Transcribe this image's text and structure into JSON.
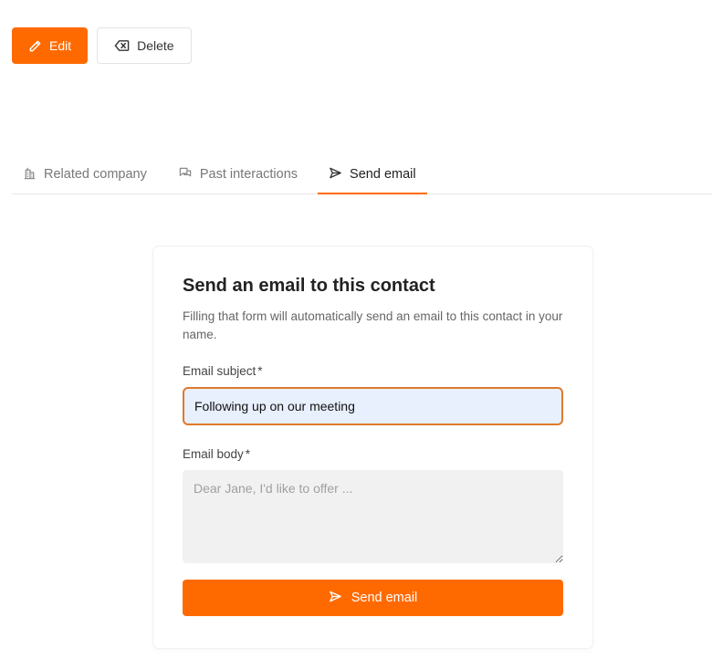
{
  "toolbar": {
    "edit_label": "Edit",
    "edit_icon": "pencil-icon",
    "delete_label": "Delete",
    "delete_icon": "backspace-x-icon"
  },
  "tabs": [
    {
      "label": "Related company",
      "icon": "building-icon",
      "active": false
    },
    {
      "label": "Past interactions",
      "icon": "chat-bubbles-icon",
      "active": false
    },
    {
      "label": "Send email",
      "icon": "send-icon",
      "active": true
    }
  ],
  "form": {
    "title": "Send an email to this contact",
    "description": "Filling that form will automatically send an email to this contact in your name.",
    "subject_label": "Email subject",
    "subject_required": "*",
    "subject_value": "Following up on our meeting",
    "body_label": "Email body",
    "body_required": "*",
    "body_placeholder": "Dear Jane, I'd like to offer ...",
    "submit_label": "Send email",
    "submit_icon": "send-icon"
  },
  "colors": {
    "accent": "#ff6a00",
    "input_focus_border": "#e07a2a",
    "input_autofill_bg": "#e8f0fe"
  }
}
